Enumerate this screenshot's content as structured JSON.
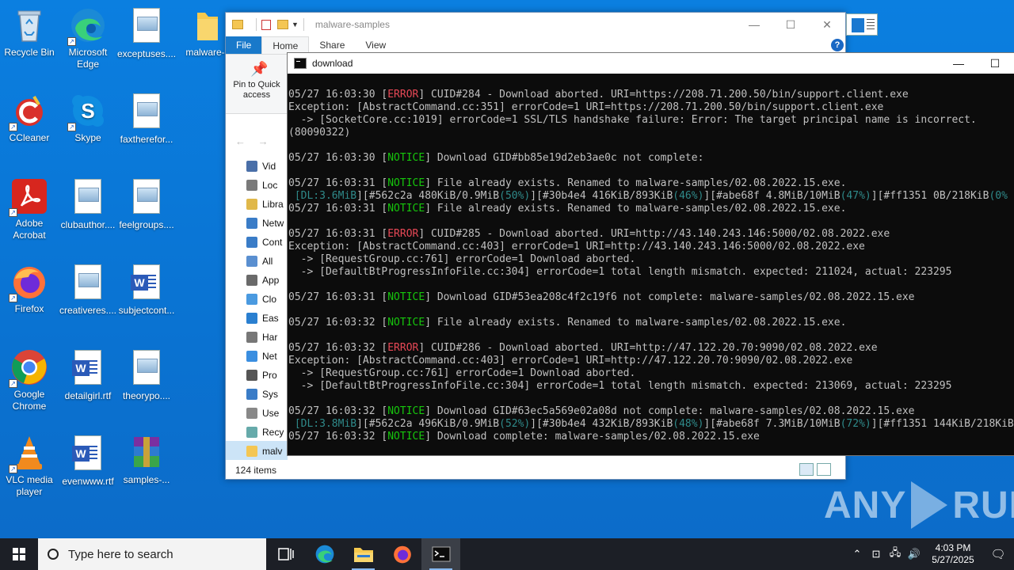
{
  "desktop_icons": [
    {
      "label": "Recycle Bin",
      "icon": "recycle-bin-icon"
    },
    {
      "label": "Microsoft Edge",
      "icon": "edge-icon"
    },
    {
      "label": "exceptuses....",
      "icon": "image-file-icon"
    },
    {
      "label": "malware-",
      "icon": "folder-icon"
    },
    {
      "label": "CCleaner",
      "icon": "ccleaner-icon"
    },
    {
      "label": "Skype",
      "icon": "skype-icon"
    },
    {
      "label": "faxtherefor...",
      "icon": "image-file-icon"
    },
    {
      "label": "Adobe Acrobat",
      "icon": "acrobat-icon"
    },
    {
      "label": "clubauthor....",
      "icon": "image-file-icon"
    },
    {
      "label": "feelgroups....",
      "icon": "image-file-icon"
    },
    {
      "label": "Firefox",
      "icon": "firefox-icon"
    },
    {
      "label": "creativeres....",
      "icon": "image-file-icon"
    },
    {
      "label": "subjectcont...",
      "icon": "word-file-icon"
    },
    {
      "label": "Google Chrome",
      "icon": "chrome-icon"
    },
    {
      "label": "detailgirl.rtf",
      "icon": "word-file-icon"
    },
    {
      "label": "theorypo....",
      "icon": "image-file-icon"
    },
    {
      "label": "VLC media player",
      "icon": "vlc-icon"
    },
    {
      "label": "evenwww.rtf",
      "icon": "word-file-icon"
    },
    {
      "label": "samples-...",
      "icon": "winrar-icon"
    }
  ],
  "explorer": {
    "title": "malware-samples",
    "tabs": [
      "File",
      "Home",
      "Share",
      "View"
    ],
    "pin_label": "Pin to Quick access",
    "nav_items": [
      "Vid",
      "Loc",
      "Libra",
      "Netw",
      "Cont",
      "All",
      "App",
      "Clo",
      "Eas",
      "Har",
      "Net",
      "Pro",
      "Sys",
      "Use",
      "Recy",
      "malv"
    ],
    "status": "124 items"
  },
  "cmd": {
    "title": "download",
    "lines": [
      [
        {
          "t": "05/27 16:03:30 ["
        },
        {
          "t": "ERROR",
          "c": "err"
        },
        {
          "t": "] CUID#284 - Download aborted. URI=https://208.71.200.50/bin/support.client.exe"
        }
      ],
      [
        {
          "t": "Exception: [AbstractCommand.cc:351] errorCode=1 URI=https://208.71.200.50/bin/support.client.exe"
        }
      ],
      [
        {
          "t": "  -> [SocketCore.cc:1019] errorCode=1 SSL/TLS handshake failure: Error: The target principal name is incorrect."
        }
      ],
      [
        {
          "t": "(80090322)"
        }
      ],
      [
        {
          "t": ""
        }
      ],
      [
        {
          "t": "05/27 16:03:30 ["
        },
        {
          "t": "NOTICE",
          "c": "ok"
        },
        {
          "t": "] Download GID#bb85e19d2eb3ae0c not complete:"
        }
      ],
      [
        {
          "t": ""
        }
      ],
      [
        {
          "t": "05/27 16:03:31 ["
        },
        {
          "t": "NOTICE",
          "c": "ok"
        },
        {
          "t": "] File already exists. Renamed to malware-samples/02.08.2022.15.exe."
        }
      ],
      [
        {
          "t": " [",
          "c": "dim"
        },
        {
          "t": "DL:",
          "c": "dim"
        },
        {
          "t": "3.6MiB",
          "c": "dim"
        },
        {
          "t": "][#562c2a 480KiB/0.9MiB"
        },
        {
          "t": "(50%)",
          "c": "dim"
        },
        {
          "t": "][#30b4e4 416KiB/893KiB"
        },
        {
          "t": "(46%)",
          "c": "dim"
        },
        {
          "t": "][#abe68f 4.8MiB/10MiB"
        },
        {
          "t": "(47%)",
          "c": "dim"
        },
        {
          "t": "][#ff1351 0B/218KiB"
        },
        {
          "t": "(0%",
          "c": "dim"
        }
      ],
      [
        {
          "t": "05/27 16:03:31 ["
        },
        {
          "t": "NOTICE",
          "c": "ok"
        },
        {
          "t": "] File already exists. Renamed to malware-samples/02.08.2022.15.exe."
        }
      ],
      [
        {
          "t": ""
        }
      ],
      [
        {
          "t": "05/27 16:03:31 ["
        },
        {
          "t": "ERROR",
          "c": "err"
        },
        {
          "t": "] CUID#285 - Download aborted. URI=http://43.140.243.146:5000/02.08.2022.exe"
        }
      ],
      [
        {
          "t": "Exception: [AbstractCommand.cc:403] errorCode=1 URI=http://43.140.243.146:5000/02.08.2022.exe"
        }
      ],
      [
        {
          "t": "  -> [RequestGroup.cc:761] errorCode=1 Download aborted."
        }
      ],
      [
        {
          "t": "  -> [DefaultBtProgressInfoFile.cc:304] errorCode=1 total length mismatch. expected: 211024, actual: 223295"
        }
      ],
      [
        {
          "t": ""
        }
      ],
      [
        {
          "t": "05/27 16:03:31 ["
        },
        {
          "t": "NOTICE",
          "c": "ok"
        },
        {
          "t": "] Download GID#53ea208c4f2c19f6 not complete: malware-samples/02.08.2022.15.exe"
        }
      ],
      [
        {
          "t": ""
        }
      ],
      [
        {
          "t": "05/27 16:03:32 ["
        },
        {
          "t": "NOTICE",
          "c": "ok"
        },
        {
          "t": "] File already exists. Renamed to malware-samples/02.08.2022.15.exe."
        }
      ],
      [
        {
          "t": ""
        }
      ],
      [
        {
          "t": "05/27 16:03:32 ["
        },
        {
          "t": "ERROR",
          "c": "err"
        },
        {
          "t": "] CUID#286 - Download aborted. URI=http://47.122.20.70:9090/02.08.2022.exe"
        }
      ],
      [
        {
          "t": "Exception: [AbstractCommand.cc:403] errorCode=1 URI=http://47.122.20.70:9090/02.08.2022.exe"
        }
      ],
      [
        {
          "t": "  -> [RequestGroup.cc:761] errorCode=1 Download aborted."
        }
      ],
      [
        {
          "t": "  -> [DefaultBtProgressInfoFile.cc:304] errorCode=1 total length mismatch. expected: 213069, actual: 223295"
        }
      ],
      [
        {
          "t": ""
        }
      ],
      [
        {
          "t": "05/27 16:03:32 ["
        },
        {
          "t": "NOTICE",
          "c": "ok"
        },
        {
          "t": "] Download GID#63ec5a569e02a08d not complete: malware-samples/02.08.2022.15.exe"
        }
      ],
      [
        {
          "t": " [",
          "c": "dim"
        },
        {
          "t": "DL:",
          "c": "dim"
        },
        {
          "t": "3.8MiB",
          "c": "dim"
        },
        {
          "t": "][#562c2a 496KiB/0.9MiB"
        },
        {
          "t": "(52%)",
          "c": "dim"
        },
        {
          "t": "][#30b4e4 432KiB/893KiB"
        },
        {
          "t": "(48%)",
          "c": "dim"
        },
        {
          "t": "][#abe68f 7.3MiB/10MiB"
        },
        {
          "t": "(72%)",
          "c": "dim"
        },
        {
          "t": "][#ff1351 144KiB/218KiB"
        }
      ],
      [
        {
          "t": "05/27 16:03:32 ["
        },
        {
          "t": "NOTICE",
          "c": "ok"
        },
        {
          "t": "] Download complete: malware-samples/02.08.2022.15.exe"
        }
      ]
    ]
  },
  "watermark": {
    "left": "ANY",
    "right": "RUN"
  },
  "taskbar": {
    "search_placeholder": "Type here to search",
    "apps": [
      "task-view-icon",
      "edge-icon",
      "file-explorer-icon",
      "firefox-icon",
      "cmd-icon"
    ],
    "time": "4:03 PM",
    "date": "5/27/2025"
  },
  "colors": {
    "error": "#e74856",
    "notice": "#16c60c",
    "progress": "#2f8a8a",
    "desktop": "#0a78d7",
    "taskbar": "#1c1f26"
  }
}
